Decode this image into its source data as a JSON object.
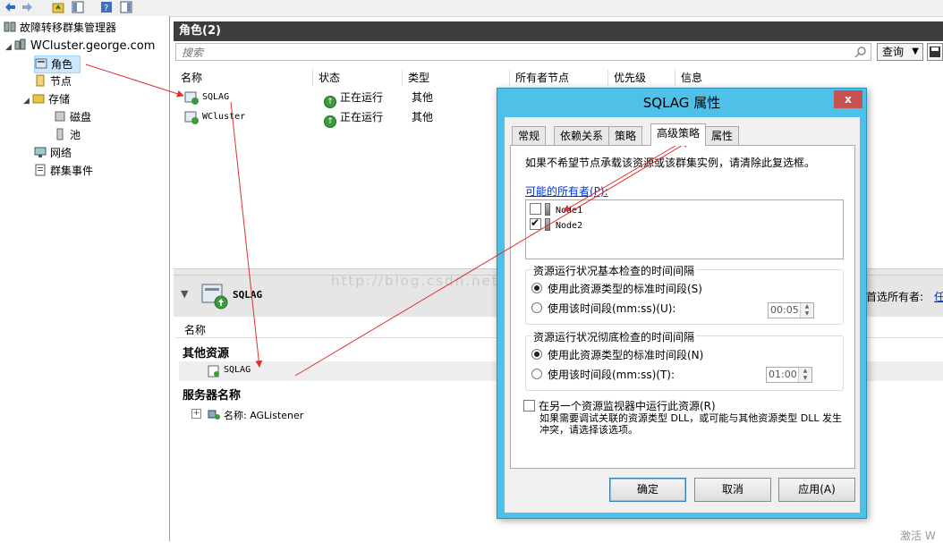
{
  "tree": {
    "root": "故障转移群集管理器",
    "cluster": "WCluster.george.com",
    "items": {
      "roles": "角色",
      "nodes": "节点",
      "storage": "存储",
      "disks": "磁盘",
      "pools": "池",
      "networks": "网络",
      "events": "群集事件"
    }
  },
  "main": {
    "header": "角色(2)",
    "search_placeholder": "搜索",
    "query_label": "查询",
    "columns": [
      "名称",
      "状态",
      "类型",
      "所有者节点",
      "优先级",
      "信息"
    ],
    "rows": [
      {
        "name": "SQLAG",
        "status": "正在运行",
        "type": "其他"
      },
      {
        "name": "WCluster",
        "status": "正在运行",
        "type": "其他"
      }
    ]
  },
  "detail": {
    "title": "SQLAG",
    "preferred_owners_label": "首选所有者:",
    "preferred_owners_link": "任",
    "col_name": "名称",
    "other_resources": "其他资源",
    "resource": "SQLAG",
    "server_name_section": "服务器名称",
    "server_name_item": "名称: AGListener"
  },
  "dialog": {
    "title": "SQLAG 属性",
    "close": "x",
    "tabs": [
      "常规",
      "依赖关系",
      "策略",
      "高级策略",
      "属性"
    ],
    "active_tab": 3,
    "description": "如果不希望节点承载该资源或该群集实例，请清除此复选框。",
    "possible_owners_label": "可能的所有者(P):",
    "owners": [
      {
        "name": "Node1",
        "checked": false
      },
      {
        "name": "Node2",
        "checked": true
      }
    ],
    "basic_check": {
      "title": "资源运行状况基本检查的时间间隔",
      "opt1": "使用此资源类型的标准时间段(S)",
      "opt2": "使用该时间段(mm:ss)(U):",
      "value": "00:05"
    },
    "thorough_check": {
      "title": "资源运行状况彻底检查的时间间隔",
      "opt1": "使用此资源类型的标准时间段(N)",
      "opt2": "使用该时间段(mm:ss)(T):",
      "value": "01:00"
    },
    "separate_monitor": {
      "label": "在另一个资源监视器中运行此资源(R)",
      "note": "如果需要调试关联的资源类型 DLL，或可能与其他资源类型 DLL 发生冲突，请选择该选项。"
    },
    "buttons": {
      "ok": "确定",
      "cancel": "取消",
      "apply": "应用(A)"
    }
  },
  "watermark": "http://blog.csdn.net/",
  "corner_text": "激活 W",
  "colors": {
    "dialog_frame": "#4fc1e9",
    "header_bar": "#3d3d3d",
    "arrow": "#e03030"
  }
}
